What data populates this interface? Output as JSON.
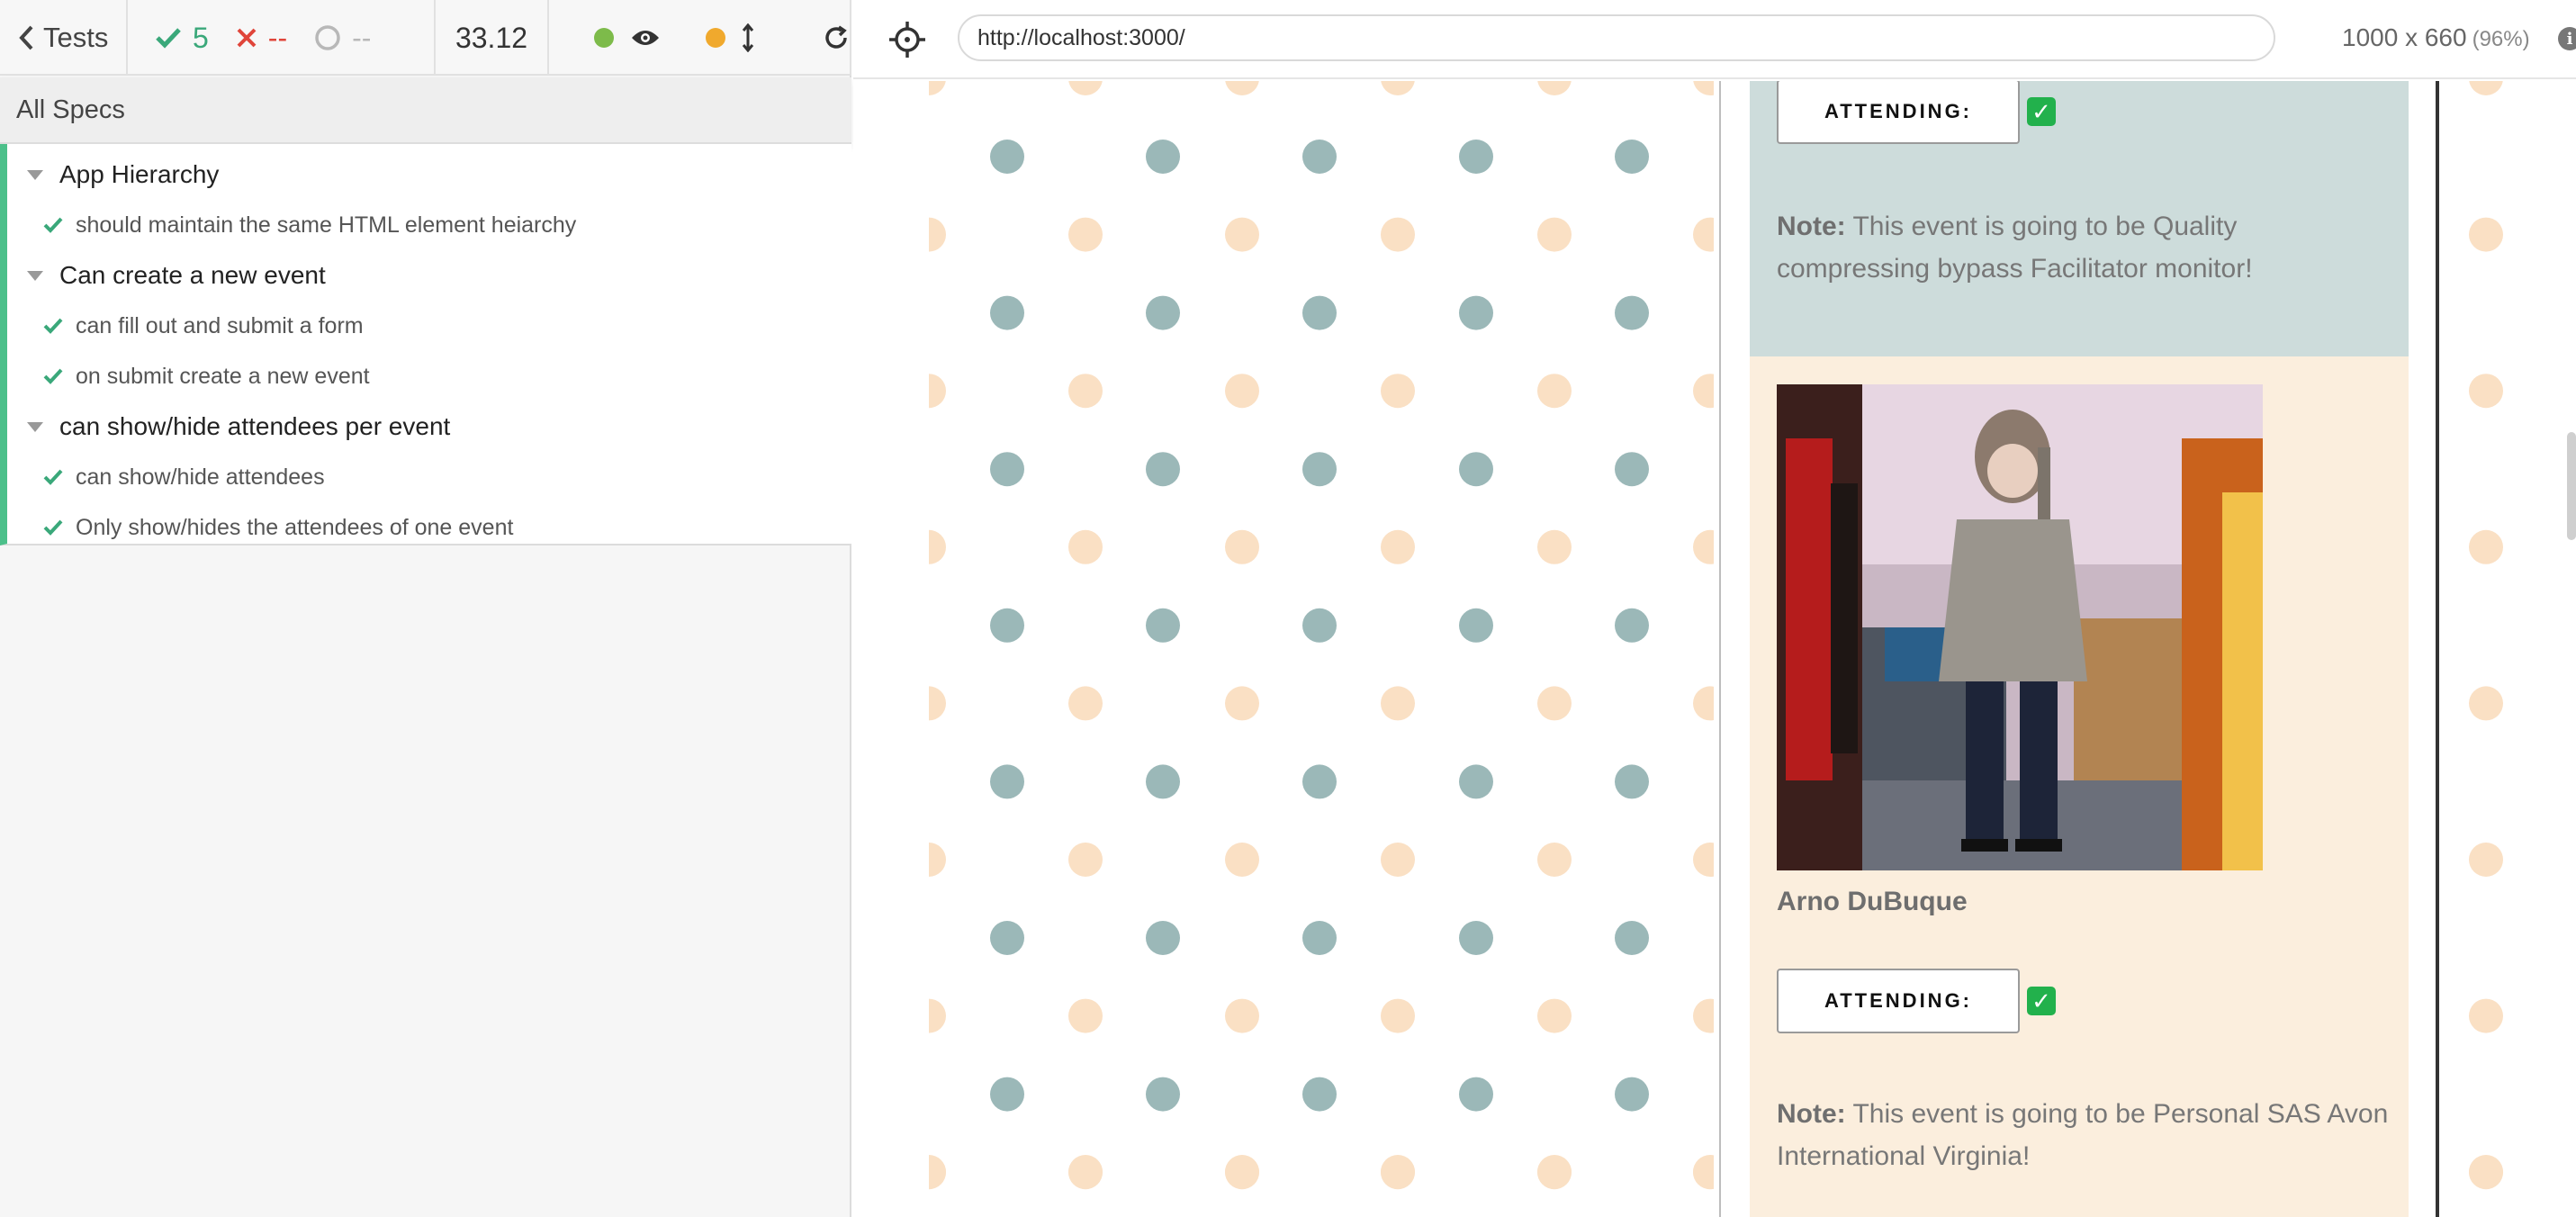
{
  "reporter": {
    "tests_label": "Tests",
    "stats": {
      "passed": "5",
      "failed": "--",
      "pending": "--"
    },
    "duration": "33.12",
    "all_specs_label": "All Specs",
    "suites": [
      {
        "title": "App Hierarchy",
        "tests": [
          "should maintain the same HTML element heiarchy"
        ]
      },
      {
        "title": "Can create a new event",
        "tests": [
          "can fill out and submit a form",
          "on submit create a new event"
        ]
      },
      {
        "title": "can show/hide attendees per event",
        "tests": [
          "can show/hide attendees",
          "Only show/hides the attendees of one event"
        ]
      }
    ]
  },
  "colors": {
    "pass": "#3aa87a",
    "fail": "#e0453a",
    "running_dot": "#7dbb4a",
    "scroll_dot": "#f0a92d",
    "dot_teal": "#9bb8b8",
    "dot_peach": "#fae0c4",
    "card_teal": "#cddcdb",
    "card_peach": "#fbeedd"
  },
  "app_toolbar": {
    "url": "http://localhost:3000/",
    "viewport_size": "1000 x 660",
    "zoom": "(96%)"
  },
  "aut": {
    "card1": {
      "attending_label": "ATTENDING:",
      "note_label": "Note:",
      "note_text": " This event is going to be Quality compressing bypass Facilitator monitor!"
    },
    "card2": {
      "attendee_name": "Arno DuBuque",
      "attending_label": "ATTENDING:",
      "note_label": "Note:",
      "note_text": " This event is going to be Personal SAS Avon International Virginia!"
    }
  },
  "icons": [
    "chevron-left-icon",
    "check-icon",
    "x-icon",
    "spinner-icon",
    "eye-icon",
    "scroll-arrows-icon",
    "reload-icon",
    "crosshair-icon",
    "info-icon"
  ]
}
